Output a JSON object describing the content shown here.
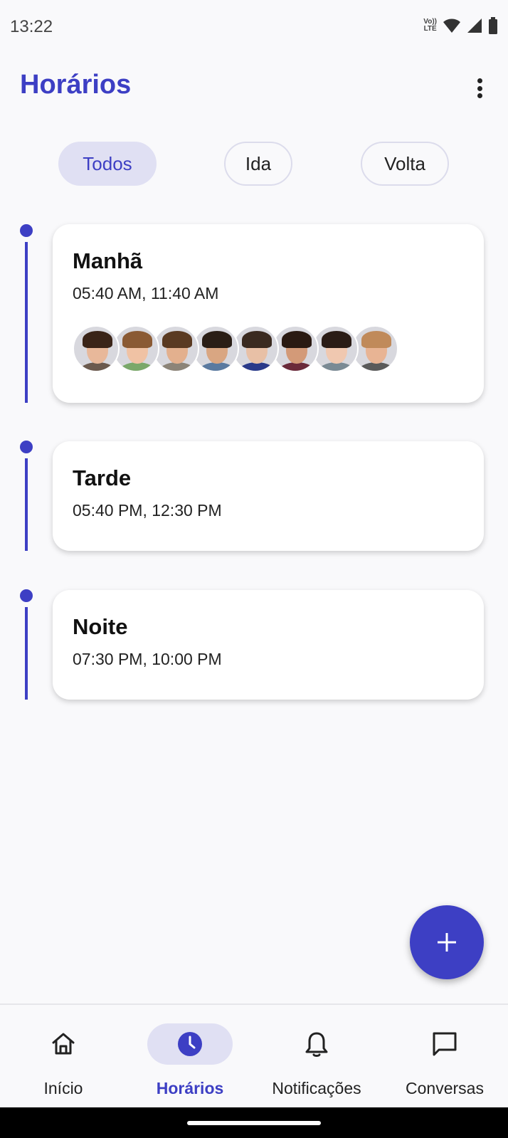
{
  "status_bar": {
    "time": "13:22",
    "volte_top": "Vo))",
    "volte_bottom": "LTE"
  },
  "header": {
    "title": "Horários"
  },
  "filters": [
    {
      "label": "Todos",
      "active": true
    },
    {
      "label": "Ida",
      "active": false
    },
    {
      "label": "Volta",
      "active": false
    }
  ],
  "schedules": [
    {
      "title": "Manhã",
      "times": "05:40 AM, 11:40 AM",
      "avatar_count": 8
    },
    {
      "title": "Tarde",
      "times": "05:40 PM, 12:30 PM"
    },
    {
      "title": "Noite",
      "times": "07:30 PM, 10:00 PM"
    }
  ],
  "avatars": [
    {
      "skin": "#e8b89a",
      "hair": "#3a2418",
      "shirt": "#6b5a4e"
    },
    {
      "skin": "#f0c2a4",
      "hair": "#8a5a34",
      "shirt": "#7aa86a"
    },
    {
      "skin": "#e3b08e",
      "hair": "#5a3a22",
      "shirt": "#8c8478"
    },
    {
      "skin": "#d9a682",
      "hair": "#2a1e16",
      "shirt": "#5a7aa0"
    },
    {
      "skin": "#e8c0a6",
      "hair": "#3a2a20",
      "shirt": "#2a3a8a"
    },
    {
      "skin": "#d39a78",
      "hair": "#2a1a12",
      "shirt": "#6a2a3a"
    },
    {
      "skin": "#f0c8b0",
      "hair": "#2a1c16",
      "shirt": "#7a8a94"
    },
    {
      "skin": "#e8b494",
      "hair": "#c08a5a",
      "shirt": "#5a5a5a"
    }
  ],
  "fab": {
    "icon": "plus-icon"
  },
  "bottom_nav": [
    {
      "label": "Início",
      "icon": "home-icon",
      "active": false
    },
    {
      "label": "Horários",
      "icon": "clock-icon",
      "active": true
    },
    {
      "label": "Notificações",
      "icon": "bell-icon",
      "active": false
    },
    {
      "label": "Conversas",
      "icon": "chat-icon",
      "active": false
    }
  ],
  "colors": {
    "accent": "#3d3fc4",
    "chip_active_bg": "#e0e0f3",
    "background": "#f9f9fb"
  }
}
